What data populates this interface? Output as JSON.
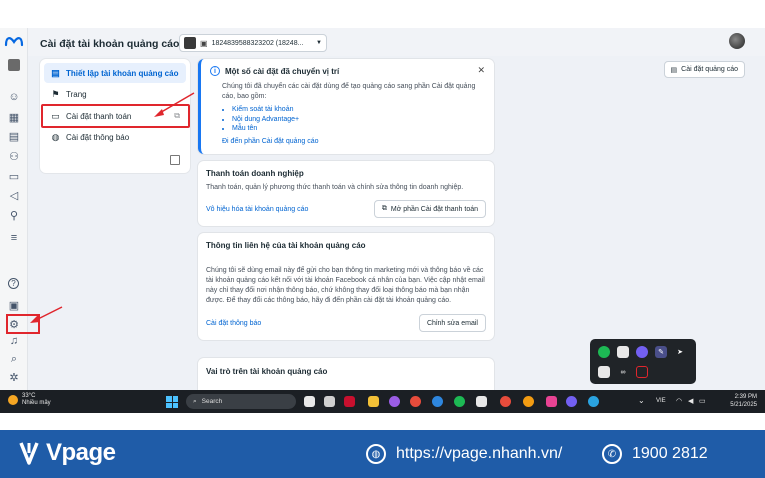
{
  "header": {
    "title": "Cài đặt tài khoản quảng cáo",
    "account_id": "1824839588323202 (18248...",
    "settings_button": "Cài đặt quảng cáo"
  },
  "nav": {
    "items": [
      {
        "label": "Thiết lập tài khoản quảng cáo",
        "icon": "user-card-icon"
      },
      {
        "label": "Trang",
        "icon": "flag-icon"
      },
      {
        "label": "Cài đặt thanh toán",
        "icon": "credit-card-icon"
      },
      {
        "label": "Cài đặt thông báo",
        "icon": "globe-icon"
      }
    ]
  },
  "info": {
    "title": "Một số cài đặt đã chuyển vị trí",
    "desc": "Chúng tôi đã chuyển các cài đặt dùng để tạo quảng cáo sang phần Cài đặt quảng cáo, bao gồm:",
    "items": [
      "Kiểm soát tài khoản",
      "Nội dung Advantage+",
      "Mẫu tên"
    ],
    "link": "Đi đến phần Cài đặt quảng cáo"
  },
  "payment": {
    "title": "Thanh toán doanh nghiệp",
    "desc": "Thanh toán, quản lý phương thức thanh toán và chính sửa thông tin doanh nghiệp.",
    "link": "Vô hiệu hóa tài khoản quảng cáo",
    "button": "Mở phần Cài đặt thanh toán"
  },
  "contact": {
    "title": "Thông tin liên hệ của tài khoản quảng cáo",
    "desc": "Chúng tôi sẽ dùng email này để gửi cho bạn thông tin marketing mới và thông báo về các tài khoản quảng cáo kết nối với tài khoản Facebook cá nhân của bạn. Việc cập nhật email này chỉ thay đổi nơi nhận thông báo, chứ không thay đổi loại thông báo mà bạn nhận được. Để thay đổi các thông báo, hãy đi đến phần cài đặt tài khoản quảng cáo.",
    "link": "Cài đặt thông báo",
    "button": "Chỉnh sửa email"
  },
  "roles": {
    "title": "Vai trò trên tài khoản quảng cáo"
  },
  "taskbar": {
    "temp": "33°C",
    "weather": "Nhiều mây",
    "search_placeholder": "Search",
    "lang": "VIE",
    "time": "2:39 PM",
    "date": "5/21/2025"
  },
  "footer": {
    "brand": "Vpage",
    "website": "https://vpage.nhanh.vn/",
    "phone": "1900 2812"
  },
  "colors": {
    "accent": "#1877f2",
    "highlight": "#e0262d",
    "footer_bg": "#1f5ca8"
  }
}
